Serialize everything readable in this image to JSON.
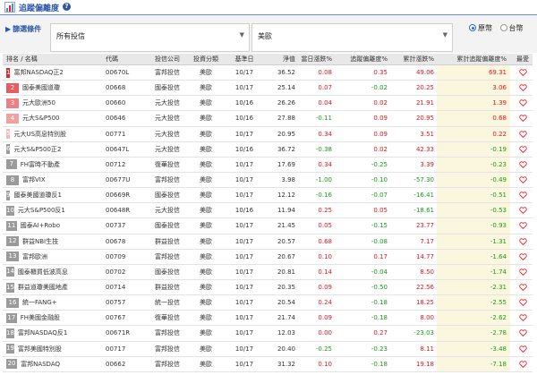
{
  "page": {
    "title": "追蹤偏離度",
    "help_icon": "?"
  },
  "filters": {
    "label": "篩選條件",
    "select_1": "所有投信",
    "select_2": "美歐",
    "currency": {
      "options": [
        "原幣",
        "台幣"
      ],
      "selected": "原幣"
    }
  },
  "table": {
    "headers": {
      "rank": "排名 / 名稱",
      "code": "代碼",
      "company": "投信公司",
      "type": "投資分類",
      "date": "基準日",
      "nav": "淨值",
      "day": "當日漲跌%",
      "dev": "追蹤偏離度%",
      "cum": "累計漲跌%",
      "cum_dev": "累計追蹤偏離度%",
      "fav": "最愛"
    },
    "rows": [
      {
        "rank": "1",
        "name": "富邦NASDAQ正2",
        "code": "00670L",
        "company": "富邦投信",
        "type": "美歐",
        "date": "10/17",
        "nav": "36.52",
        "day": "0.08",
        "dev": "0.35",
        "cum": "49.06",
        "cum_dev": "69.31"
      },
      {
        "rank": "2",
        "name": "國泰美國道瓊",
        "code": "00668",
        "company": "國泰投信",
        "type": "美歐",
        "date": "10/17",
        "nav": "25.14",
        "day": "0.07",
        "dev": "-0.02",
        "cum": "20.25",
        "cum_dev": "3.06"
      },
      {
        "rank": "3",
        "name": "元大歐洲50",
        "code": "00660",
        "company": "元大投信",
        "type": "美歐",
        "date": "10/16",
        "nav": "26.26",
        "day": "0.04",
        "dev": "0.02",
        "cum": "21.91",
        "cum_dev": "1.39"
      },
      {
        "rank": "4",
        "name": "元大S&P500",
        "code": "00646",
        "company": "元大投信",
        "type": "美歐",
        "date": "10/16",
        "nav": "27.88",
        "day": "-0.11",
        "dev": "0.09",
        "cum": "20.95",
        "cum_dev": "0.68"
      },
      {
        "rank": "5",
        "name": "元大US高息特別股",
        "code": "00771",
        "company": "元大投信",
        "type": "美歐",
        "date": "10/17",
        "nav": "20.95",
        "day": "0.34",
        "dev": "0.09",
        "cum": "3.51",
        "cum_dev": "0.22"
      },
      {
        "rank": "6",
        "name": "元大S&P500正2",
        "code": "00647L",
        "company": "元大投信",
        "type": "美歐",
        "date": "10/16",
        "nav": "36.72",
        "day": "-0.38",
        "dev": "0.02",
        "cum": "42.33",
        "cum_dev": "-0.19"
      },
      {
        "rank": "7",
        "name": "FH富時不動產",
        "code": "00712",
        "company": "復華投信",
        "type": "美歐",
        "date": "10/17",
        "nav": "17.69",
        "day": "0.34",
        "dev": "-0.25",
        "cum": "3.39",
        "cum_dev": "-0.23"
      },
      {
        "rank": "8",
        "name": "富邦VIX",
        "code": "00677U",
        "company": "富邦投信",
        "type": "美歐",
        "date": "10/17",
        "nav": "3.98",
        "day": "-1.00",
        "dev": "-0.10",
        "cum": "-57.30",
        "cum_dev": "-0.49"
      },
      {
        "rank": "9",
        "name": "國泰美國道瓊反1",
        "code": "00669R",
        "company": "國泰投信",
        "type": "美歐",
        "date": "10/17",
        "nav": "12.12",
        "day": "-0.16",
        "dev": "-0.07",
        "cum": "-16.41",
        "cum_dev": "-0.51"
      },
      {
        "rank": "10",
        "name": "元大S&P500反1",
        "code": "00648R",
        "company": "元大投信",
        "type": "美歐",
        "date": "10/16",
        "nav": "11.94",
        "day": "0.25",
        "dev": "0.05",
        "cum": "-18.61",
        "cum_dev": "-0.53"
      },
      {
        "rank": "11",
        "name": "國泰AI+Robo",
        "code": "00737",
        "company": "國泰投信",
        "type": "美歐",
        "date": "10/17",
        "nav": "21.45",
        "day": "0.05",
        "dev": "-0.15",
        "cum": "23.77",
        "cum_dev": "-0.93"
      },
      {
        "rank": "12",
        "name": "群益NBI生技",
        "code": "00678",
        "company": "群益投信",
        "type": "美歐",
        "date": "10/17",
        "nav": "20.57",
        "day": "0.68",
        "dev": "-0.08",
        "cum": "7.17",
        "cum_dev": "-1.31"
      },
      {
        "rank": "13",
        "name": "富邦歐洲",
        "code": "00709",
        "company": "富邦投信",
        "type": "美歐",
        "date": "10/17",
        "nav": "20.67",
        "day": "0.10",
        "dev": "0.17",
        "cum": "14.77",
        "cum_dev": "-1.64"
      },
      {
        "rank": "14",
        "name": "國泰櫃買低波高息",
        "code": "00702",
        "company": "國泰投信",
        "type": "美歐",
        "date": "10/17",
        "nav": "20.81",
        "day": "0.14",
        "dev": "-0.04",
        "cum": "8.50",
        "cum_dev": "-1.74"
      },
      {
        "rank": "15",
        "name": "群益道瓊美國地產",
        "code": "00714",
        "company": "群益投信",
        "type": "美歐",
        "date": "10/17",
        "nav": "20.35",
        "day": "0.09",
        "dev": "-0.50",
        "cum": "22.56",
        "cum_dev": "-2.31"
      },
      {
        "rank": "16",
        "name": "統一FANG+",
        "code": "00757",
        "company": "統一投信",
        "type": "美歐",
        "date": "10/17",
        "nav": "20.54",
        "day": "0.24",
        "dev": "-0.18",
        "cum": "18.25",
        "cum_dev": "-2.55"
      },
      {
        "rank": "17",
        "name": "FH美國金融股",
        "code": "00767",
        "company": "復華投信",
        "type": "美歐",
        "date": "10/17",
        "nav": "21.74",
        "day": "0.09",
        "dev": "-0.18",
        "cum": "8.00",
        "cum_dev": "-2.62"
      },
      {
        "rank": "18",
        "name": "富邦NASDAQ反1",
        "code": "00671R",
        "company": "富邦投信",
        "type": "美歐",
        "date": "10/17",
        "nav": "12.03",
        "day": "0.00",
        "dev": "0.27",
        "cum": "-23.03",
        "cum_dev": "-2.78"
      },
      {
        "rank": "19",
        "name": "富邦美國特別股",
        "code": "00717",
        "company": "富邦投信",
        "type": "美歐",
        "date": "10/17",
        "nav": "20.40",
        "day": "-0.25",
        "dev": "-0.23",
        "cum": "8.11",
        "cum_dev": "-3.48"
      },
      {
        "rank": "20",
        "name": "富邦NASDAQ",
        "code": "00662",
        "company": "富邦投信",
        "type": "美歐",
        "date": "10/17",
        "nav": "31.32",
        "day": "0.10",
        "dev": "-0.18",
        "cum": "19.18",
        "cum_dev": "-7.18"
      }
    ]
  },
  "colors": {
    "accent": "#2b55a8",
    "positive": "#e0151c",
    "negative": "#1a9a1a",
    "rank_top": [
      "#e0262d",
      "#ea5b5f",
      "#ef7f82",
      "#f3a0a2",
      "#f6b9bb"
    ],
    "rank_rest": "#9a9a9a",
    "highlight": "#fbf7df",
    "heart": "#e0262d"
  }
}
